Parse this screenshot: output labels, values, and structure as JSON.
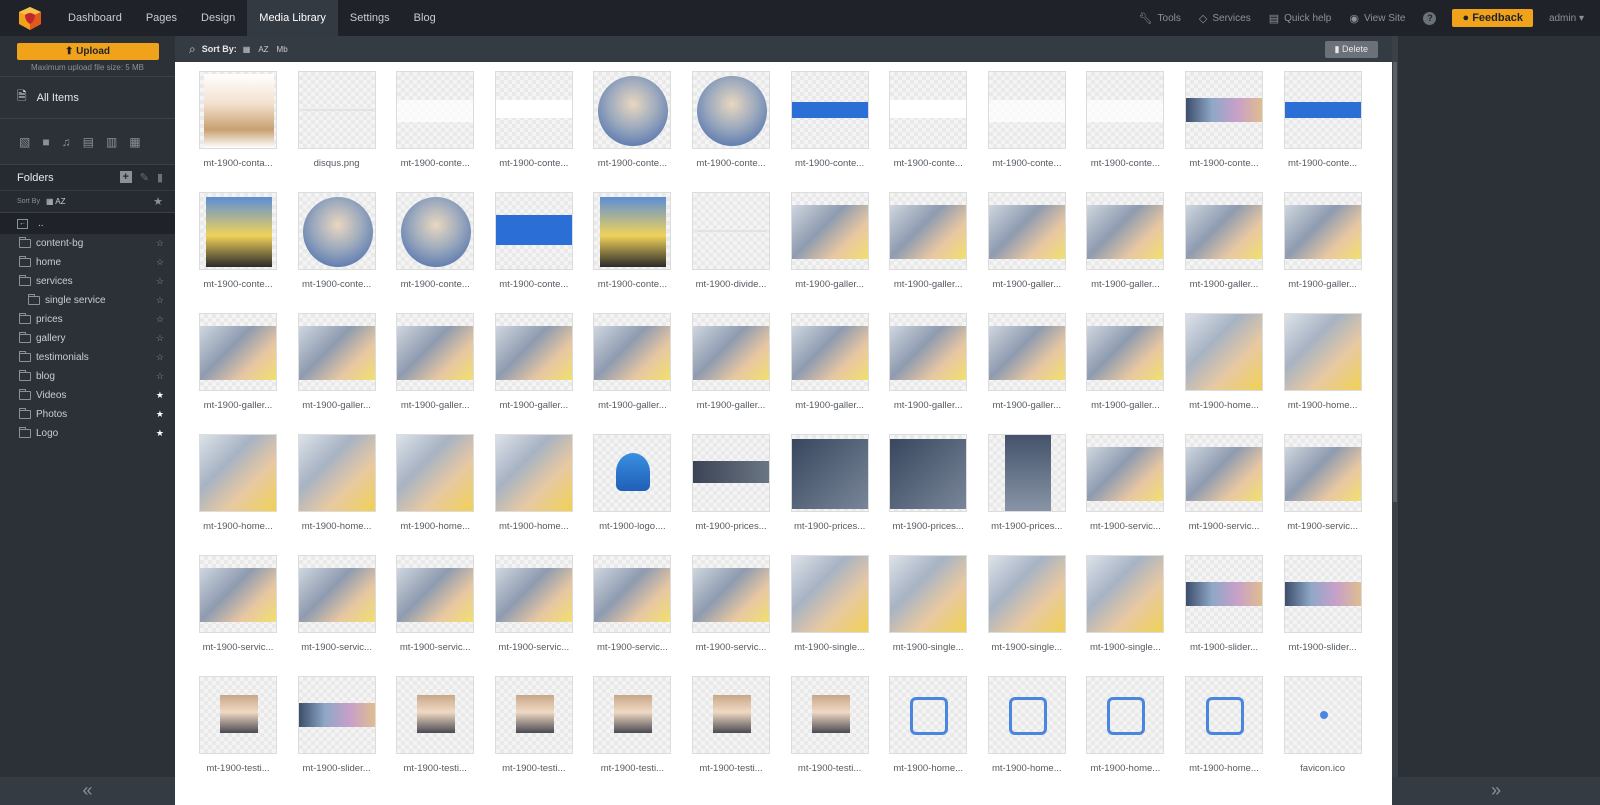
{
  "nav": {
    "items": [
      {
        "label": "Dashboard",
        "active": false
      },
      {
        "label": "Pages",
        "active": false
      },
      {
        "label": "Design",
        "active": false
      },
      {
        "label": "Media Library",
        "active": true
      },
      {
        "label": "Settings",
        "active": false
      },
      {
        "label": "Blog",
        "active": false
      }
    ],
    "right": {
      "tools": "Tools",
      "services": "Services",
      "quick_help": "Quick help",
      "view_site": "View Site",
      "help": "?",
      "feedback": "Feedback",
      "admin": "admin"
    }
  },
  "sidebar": {
    "upload_label": "Upload",
    "upload_note": "Maximum upload file size: 5 MB",
    "all_items": "All Items",
    "folders_title": "Folders",
    "sort_by": "Sort By",
    "sort_az": "AZ",
    "up": "..",
    "folders": [
      {
        "label": "content-bg",
        "starred": false,
        "sub": false
      },
      {
        "label": "home",
        "starred": false,
        "sub": false
      },
      {
        "label": "services",
        "starred": false,
        "sub": false
      },
      {
        "label": "single service",
        "starred": false,
        "sub": true
      },
      {
        "label": "prices",
        "starred": false,
        "sub": false
      },
      {
        "label": "gallery",
        "starred": false,
        "sub": false
      },
      {
        "label": "testimonials",
        "starred": false,
        "sub": false
      },
      {
        "label": "blog",
        "starred": false,
        "sub": false
      },
      {
        "label": "Videos",
        "starred": true,
        "sub": false
      },
      {
        "label": "Photos",
        "starred": true,
        "sub": false
      },
      {
        "label": "Logo",
        "starred": true,
        "sub": false
      }
    ],
    "collapse_glyph": "«"
  },
  "toolbar": {
    "sort_by": "Sort By:",
    "sort_az": "AZ",
    "sort_mb": "Mb",
    "delete": "Delete"
  },
  "right_panel": {
    "expand_glyph": "»"
  },
  "colors": {
    "accent": "#f1a21b",
    "nav_bg": "#1f2329",
    "sidebar_bg": "#2c3138",
    "photo_blue": "#2b6fd6"
  },
  "media": [
    {
      "label": "mt-1900-conta...",
      "kind": "person"
    },
    {
      "label": "disqus.png",
      "kind": "thinline"
    },
    {
      "label": "mt-1900-conte...",
      "kind": "blank"
    },
    {
      "label": "mt-1900-conte...",
      "kind": "whitebar"
    },
    {
      "label": "mt-1900-conte...",
      "kind": "circle"
    },
    {
      "label": "mt-1900-conte...",
      "kind": "circle"
    },
    {
      "label": "mt-1900-conte...",
      "kind": "bluebar"
    },
    {
      "label": "mt-1900-conte...",
      "kind": "whitebar"
    },
    {
      "label": "mt-1900-conte...",
      "kind": "blank"
    },
    {
      "label": "mt-1900-conte...",
      "kind": "blank"
    },
    {
      "label": "mt-1900-conte...",
      "kind": "photobar"
    },
    {
      "label": "mt-1900-conte...",
      "kind": "bluebar"
    },
    {
      "label": "mt-1900-conte...",
      "kind": "cart"
    },
    {
      "label": "mt-1900-conte...",
      "kind": "circle"
    },
    {
      "label": "mt-1900-conte...",
      "kind": "circle"
    },
    {
      "label": "mt-1900-conte...",
      "kind": "bluebox"
    },
    {
      "label": "mt-1900-conte...",
      "kind": "cart"
    },
    {
      "label": "mt-1900-divide...",
      "kind": "thinline"
    },
    {
      "label": "mt-1900-galler...",
      "kind": "photo"
    },
    {
      "label": "mt-1900-galler...",
      "kind": "photo"
    },
    {
      "label": "mt-1900-galler...",
      "kind": "photo"
    },
    {
      "label": "mt-1900-galler...",
      "kind": "photo"
    },
    {
      "label": "mt-1900-galler...",
      "kind": "photo"
    },
    {
      "label": "mt-1900-galler...",
      "kind": "photo"
    },
    {
      "label": "mt-1900-galler...",
      "kind": "photo"
    },
    {
      "label": "mt-1900-galler...",
      "kind": "photo"
    },
    {
      "label": "mt-1900-galler...",
      "kind": "photo"
    },
    {
      "label": "mt-1900-galler...",
      "kind": "photo"
    },
    {
      "label": "mt-1900-galler...",
      "kind": "photo"
    },
    {
      "label": "mt-1900-galler...",
      "kind": "photo"
    },
    {
      "label": "mt-1900-galler...",
      "kind": "photo"
    },
    {
      "label": "mt-1900-galler...",
      "kind": "photo"
    },
    {
      "label": "mt-1900-galler...",
      "kind": "photo"
    },
    {
      "label": "mt-1900-galler...",
      "kind": "photo"
    },
    {
      "label": "mt-1900-home...",
      "kind": "full"
    },
    {
      "label": "mt-1900-home...",
      "kind": "full"
    },
    {
      "label": "mt-1900-home...",
      "kind": "full"
    },
    {
      "label": "mt-1900-home...",
      "kind": "full"
    },
    {
      "label": "mt-1900-home...",
      "kind": "full"
    },
    {
      "label": "mt-1900-home...",
      "kind": "full"
    },
    {
      "label": "mt-1900-logo....",
      "kind": "logo"
    },
    {
      "label": "mt-1900-prices...",
      "kind": "darkbar"
    },
    {
      "label": "mt-1900-prices...",
      "kind": "dark"
    },
    {
      "label": "mt-1900-prices...",
      "kind": "dark"
    },
    {
      "label": "mt-1900-prices...",
      "kind": "darktall"
    },
    {
      "label": "mt-1900-servic...",
      "kind": "photo"
    },
    {
      "label": "mt-1900-servic...",
      "kind": "photo"
    },
    {
      "label": "mt-1900-servic...",
      "kind": "photo"
    },
    {
      "label": "mt-1900-servic...",
      "kind": "photo"
    },
    {
      "label": "mt-1900-servic...",
      "kind": "photo"
    },
    {
      "label": "mt-1900-servic...",
      "kind": "photo"
    },
    {
      "label": "mt-1900-servic...",
      "kind": "photo"
    },
    {
      "label": "mt-1900-servic...",
      "kind": "photo"
    },
    {
      "label": "mt-1900-servic...",
      "kind": "photo"
    },
    {
      "label": "mt-1900-single...",
      "kind": "full"
    },
    {
      "label": "mt-1900-single...",
      "kind": "full"
    },
    {
      "label": "mt-1900-single...",
      "kind": "full"
    },
    {
      "label": "mt-1900-single...",
      "kind": "full"
    },
    {
      "label": "mt-1900-slider...",
      "kind": "photobar"
    },
    {
      "label": "mt-1900-slider...",
      "kind": "photobar"
    },
    {
      "label": "mt-1900-testi...",
      "kind": "portrait"
    },
    {
      "label": "mt-1900-slider...",
      "kind": "photobar"
    },
    {
      "label": "mt-1900-testi...",
      "kind": "portrait"
    },
    {
      "label": "mt-1900-testi...",
      "kind": "portrait"
    },
    {
      "label": "mt-1900-testi...",
      "kind": "portrait"
    },
    {
      "label": "mt-1900-testi...",
      "kind": "portrait"
    },
    {
      "label": "mt-1900-testi...",
      "kind": "portrait"
    },
    {
      "label": "mt-1900-home...",
      "kind": "icon"
    },
    {
      "label": "mt-1900-home...",
      "kind": "icon"
    },
    {
      "label": "mt-1900-home...",
      "kind": "icon"
    },
    {
      "label": "mt-1900-home...",
      "kind": "icon"
    },
    {
      "label": "favicon.ico",
      "kind": "tiny"
    }
  ]
}
